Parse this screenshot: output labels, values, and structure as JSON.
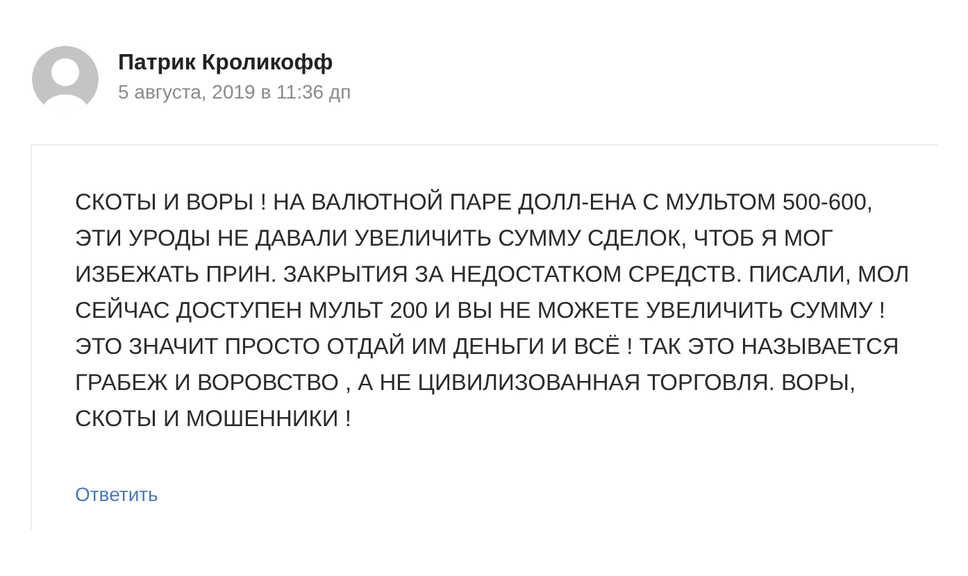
{
  "comment": {
    "author": "Патрик Кроликофф",
    "date": "5 августа, 2019 в 11:36 дп",
    "text": "СКОТЫ И ВОРЫ ! НА ВАЛЮТНОЙ ПАРЕ ДОЛЛ-ЕНА С МУЛЬТОМ 500-600, ЭТИ УРОДЫ НЕ ДАВАЛИ УВЕЛИЧИТЬ СУММУ СДЕЛОК, ЧТОБ Я МОГ ИЗБЕЖАТЬ ПРИН. ЗАКРЫТИЯ ЗА НЕДОСТАТКОМ СРЕДСТВ. ПИСАЛИ, МОЛ СЕЙЧАС ДОСТУПЕН МУЛЬТ 200 И ВЫ НЕ МОЖЕТЕ УВЕЛИЧИТЬ СУММУ ! ЭТО ЗНАЧИТ ПРОСТО ОТДАЙ ИМ ДЕНЬГИ И ВСЁ ! ТАК ЭТО НАЗЫВАЕТСЯ ГРАБЕЖ И ВОРОВСТВО , А НЕ ЦИВИЛИЗОВАННАЯ ТОРГОВЛЯ. ВОРЫ, СКОТЫ И МОШЕННИКИ !",
    "reply_link": "Ответить"
  }
}
